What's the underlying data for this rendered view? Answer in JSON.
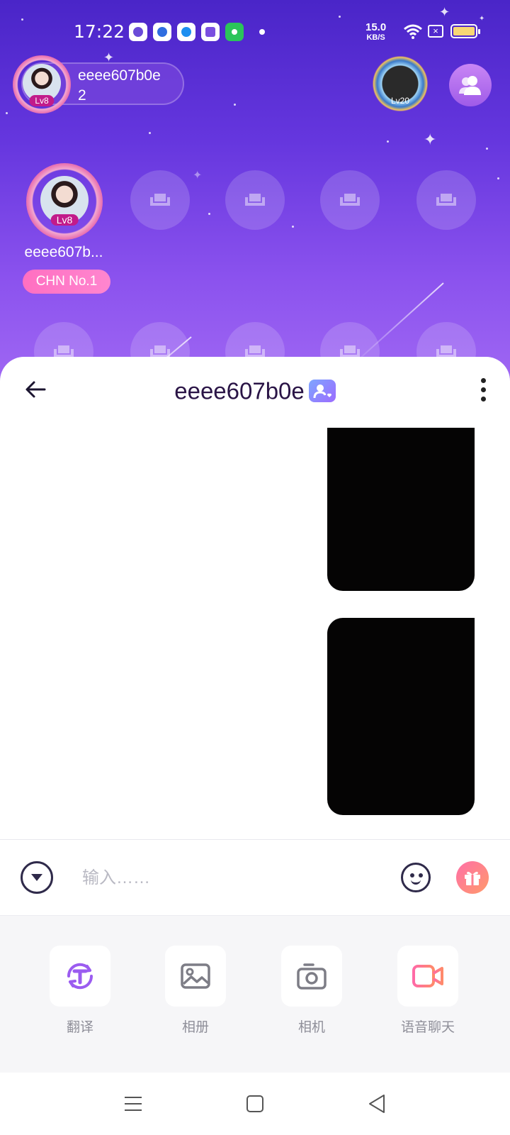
{
  "status_bar": {
    "time": "17:22",
    "net_speed_value": "15.0",
    "net_speed_unit": "KB/S"
  },
  "room": {
    "host": {
      "name": "eeee607b0e",
      "count": "2",
      "level": "Lv8"
    },
    "vip_badge_level": "Lv20",
    "seat_host": {
      "name": "eeee607b...",
      "level": "Lv8",
      "badge": "CHN No.1"
    }
  },
  "chat": {
    "title": "eeee607b0e",
    "input_placeholder": "输入……"
  },
  "tools": [
    {
      "label": "翻译"
    },
    {
      "label": "相册"
    },
    {
      "label": "相机"
    },
    {
      "label": "语音聊天"
    }
  ],
  "colors": {
    "room_gradient_top": "#4a25c8",
    "room_gradient_bottom": "#a26af4",
    "badge_pink": "#ff6fc1",
    "title_color": "#2a1446"
  }
}
